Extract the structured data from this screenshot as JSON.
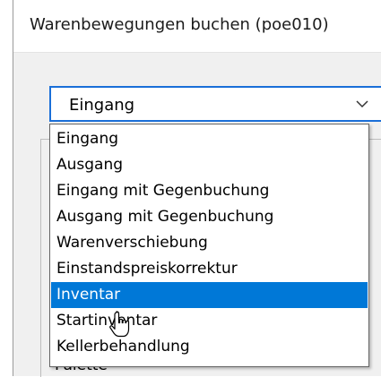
{
  "window": {
    "title": "Warenbewegungen buchen (poe010)"
  },
  "combo": {
    "selected_value": "Eingang",
    "icon": "chevron-down-icon"
  },
  "dropdown": {
    "options": [
      "Eingang",
      "Ausgang",
      "Eingang mit Gegenbuchung",
      "Ausgang mit Gegenbuchung",
      "Warenverschiebung",
      "Einstandspreiskorrektur",
      "Inventar",
      "Startinventar",
      "Kellerbehandlung"
    ],
    "highlighted": "Inventar",
    "highlight_color": "#0078d7"
  },
  "background": {
    "partial_label": "Palette"
  }
}
